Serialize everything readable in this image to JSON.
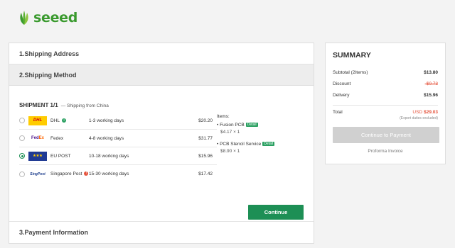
{
  "brand": {
    "name": "seeed",
    "color": "#3a9a2e"
  },
  "sections": {
    "address": "1.Shipping Address",
    "method": "2.Shipping Method",
    "payment": "3.Payment Information"
  },
  "shipment": {
    "title": "SHIPMENT 1/1",
    "from": "— Shipping from China",
    "carriers": [
      {
        "logo": "DHL",
        "name": "DHL",
        "days": "1-3 working days",
        "price": "$20.20",
        "info": "green",
        "selected": false
      },
      {
        "logo": "FedEx",
        "name": "Fedex",
        "days": "4-8 working days",
        "price": "$31.77",
        "info": "none",
        "selected": false
      },
      {
        "logo": "EU POST",
        "name": "EU POST",
        "days": "10-18 working days",
        "price": "$15.96",
        "info": "none",
        "selected": true
      },
      {
        "logo": "SingPost",
        "name": "Singapore Post",
        "days": "15-30 working days",
        "price": "$17.42",
        "info": "red",
        "selected": false
      }
    ],
    "items_label": "Items:",
    "items": [
      {
        "name": "• Fusion PCB",
        "tag": "Detail",
        "price": "$4.17 × 1"
      },
      {
        "name": "• PCB Stencil Service",
        "tag": "Detail",
        "price": "$8.90 × 1"
      }
    ],
    "continue_label": "Continue"
  },
  "summary": {
    "title": "SUMMARY",
    "subtotal_label": "Subtotal (2Items)",
    "subtotal": "$13.80",
    "discount_label": "Discount",
    "discount": "-$0.73",
    "delivery_label": "Delivery",
    "delivery": "$15.96",
    "total_label": "Total",
    "total_currency": "USD",
    "total": "$29.03",
    "export_note": "(Export duties excluded)",
    "pay_label": "Continue to Payment",
    "proforma_label": "Proforma Invoice"
  },
  "colors": {
    "accent": "#1d8f55",
    "alert": "#e5533c",
    "disabled": "#d0d0d0"
  }
}
